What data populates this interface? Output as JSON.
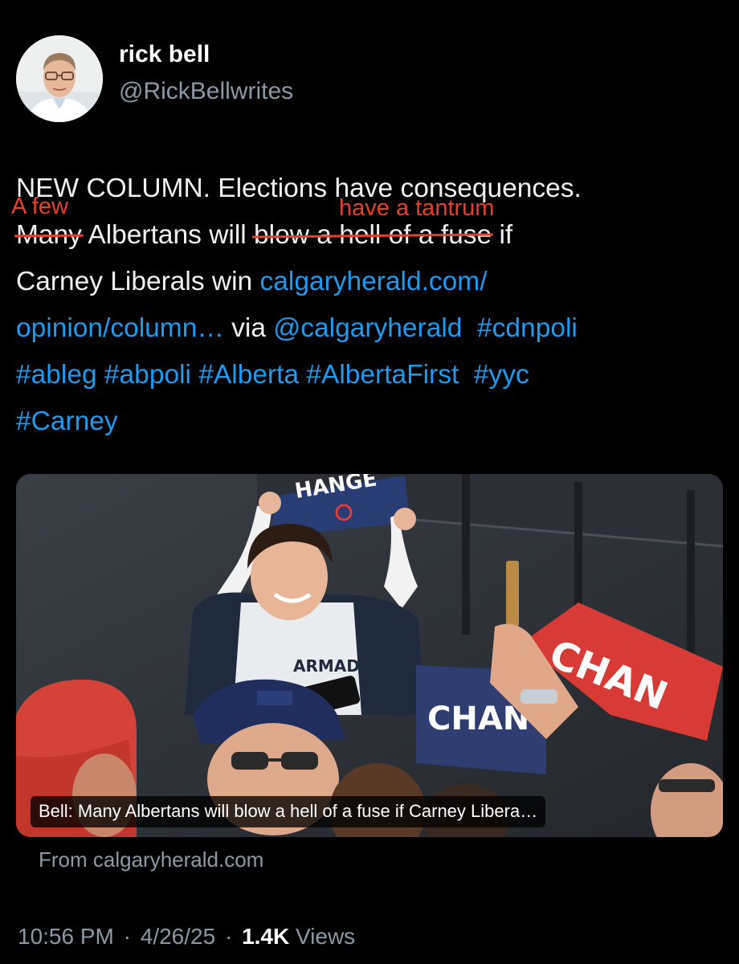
{
  "author": {
    "display_name": "rick bell",
    "handle": "@RickBellwrites"
  },
  "tweet": {
    "line1": "NEW COLUMN. Elections have consequences.",
    "line2_struck_many": "Many",
    "line2_mid": " Albertans will ",
    "line2_struck_phrase": "blow a hell of a fuse",
    "line2_end": " if",
    "line3_text": "Carney Liberals win ",
    "line3_link": "calgaryherald.com/",
    "line4_link": "opinion/column…",
    "line4_via": " via ",
    "mention": "@calgaryherald",
    "hashtags": {
      "cdnpoli": "#cdnpoli",
      "ableg": "#ableg",
      "abpoli": "#abpoli",
      "alberta": "#Alberta",
      "albertafirst": "#AlbertaFirst",
      "yyc": "#yyc",
      "carney": "#Carney"
    }
  },
  "annotations": {
    "replace_many": "A few",
    "replace_phrase": "have a tantrum",
    "color": "#e4402b"
  },
  "link_card": {
    "caption": "Bell: Many Albertans will blow a hell of a fuse if Carney Libera…",
    "source": "From calgaryherald.com",
    "photo_signs": {
      "top_sign": "HANGE",
      "red_sign": "CHAN",
      "blue_sign": "CHAN"
    }
  },
  "meta": {
    "time": "10:56 PM",
    "date": "4/26/25",
    "separator": "·",
    "views_count": "1.4K",
    "views_label": "Views"
  },
  "colors": {
    "background": "#000000",
    "link": "#1d9bf0",
    "secondary_text": "#8b98a5",
    "annotation_red": "#e4402b"
  }
}
